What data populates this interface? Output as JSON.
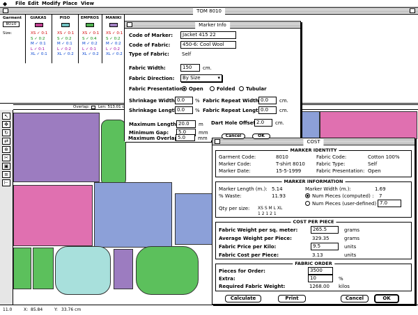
{
  "menubar": {
    "items": [
      "File",
      "Edit",
      "Modify",
      "Place",
      "View"
    ]
  },
  "main_window": {
    "title": "TOM 8010"
  },
  "top_panel": {
    "garment_label": "Garment",
    "garment_value": "8010",
    "size_label": "Size:",
    "columns": [
      {
        "name": "GIAKAS",
        "color": "#c04090",
        "sizes": [
          "XS ✓ 0:1",
          "S ✓ 0:2",
          "M ✓ 0:1",
          "L ✓ 0:1",
          "XL ✓ 0:1"
        ]
      },
      {
        "name": "PISO",
        "color": "#70c0c0",
        "sizes": [
          "XS ✓ 0:1",
          "S ✓ 0:2",
          "M ✓ 0:1",
          "L ✓ 0:2",
          "XL ✓ 0:2"
        ]
      },
      {
        "name": "EMPROS",
        "color": "#50b050",
        "sizes": [
          "XS ✓ 0:1",
          "S ✓ 0:4",
          "M ✓ 0:2",
          "L ✓ 0:1",
          "XL ✓ 0:2"
        ]
      },
      {
        "name": "MANIKI",
        "color": "#a080c0",
        "sizes": [
          "XS ✓ 0:1",
          "S ✓ 0:2",
          "M ✓ 0:2",
          "L ✓ 0:2",
          "XL ✓ 0:2"
        ]
      }
    ]
  },
  "ruler": {
    "overlap_label": "Overlap:",
    "len_label": "Len: 513.01 cm"
  },
  "status": {
    "zoom": "11.0",
    "x_label": "X:",
    "x_value": "85.84",
    "y_label": "Y:",
    "y_value": "33.76 cm"
  },
  "marker_info": {
    "title": "Marker Info",
    "code_of_marker_label": "Code of Marker:",
    "code_of_marker": "Jacket 415 22",
    "code_of_fabric_label": "Code of Fabric:",
    "code_of_fabric": "450-6: Cool Wool",
    "type_of_fabric_label": "Type of Fabric:",
    "type_of_fabric": "Self",
    "fabric_width_label": "Fabric Width:",
    "fabric_width": "150",
    "fabric_width_unit": "cm.",
    "fabric_direction_label": "Fabric Direction:",
    "fabric_direction": "By Size",
    "fabric_presentation_label": "Fabric Presentation:",
    "presentation_options": [
      "Open",
      "Folded",
      "Tubular"
    ],
    "presentation_selected": "Open",
    "shrinkage_width_label": "Shrinkage Width:",
    "shrinkage_width": "0.0",
    "shrinkage_length_label": "Shrinkage Length:",
    "shrinkage_length": "0.0",
    "pct": "%",
    "repeat_width_label": "Fabric Repeat Width:",
    "repeat_width": "0.0",
    "repeat_length_label": "Fabric Repeat Length:",
    "repeat_length": "0.0",
    "max_length_label": "Maximum Length:",
    "max_length": "20.0",
    "max_length_unit": "m",
    "min_gap_label": "Minimum Gap:",
    "min_gap": "5.0",
    "min_gap_unit": "mm",
    "max_overlap_label": "Maximum Overlap:",
    "max_overlap": "5.0",
    "max_overlap_unit": "mm",
    "dart_hole_label": "Dart Hole Offset:",
    "dart_hole": "2.0",
    "cm": "cm.",
    "cancel": "Cancel",
    "ok": "OK"
  },
  "cost": {
    "title": "COST",
    "marker_identity": {
      "title": "MARKER IDENTITY",
      "garment_code_label": "Garment Code:",
      "garment_code": "8010",
      "marker_code_label": "Marker Code:",
      "marker_code": "T-shirt 8010",
      "marker_date_label": "Marker Date:",
      "marker_date": "15-5-1999",
      "fabric_code_label": "Fabric Code:",
      "fabric_code": "Cotton 100%",
      "fabric_type_label": "Fabric Type:",
      "fabric_type": "Self",
      "fabric_presentation_label": "Fabric Presentation:",
      "fabric_presentation": "Open"
    },
    "marker_information": {
      "title": "MARKER INFORMATION",
      "length_label": "Marker Length (m.):",
      "length": "5.14",
      "waste_label": "% Waste:",
      "waste": "11.93",
      "width_label": "Marker Width (m.):",
      "width": "1.69",
      "num_computed_label": "Num Pieces (computed) :",
      "num_computed": "7",
      "num_user_label": "Num Pieces (user-defined) :",
      "num_user": "7.0",
      "qty_label": "Qty per size:",
      "qty_sizes": "XS S M L XL",
      "qty_values": "1  2  1  2  1"
    },
    "cost_per_piece": {
      "title": "COST PER PIECE",
      "weight_label": "Fabric Weight per sq. meter:",
      "weight": "265.5",
      "weight_unit": "grams",
      "avg_label": "Average Weight per Piece:",
      "avg": "329.35",
      "avg_unit": "grams",
      "price_label": "Fabric Price per Kilo:",
      "price": "9.5",
      "price_unit": "units",
      "fcost_label": "Fabric Cost per Piece:",
      "fcost": "3.13",
      "fcost_unit": "units"
    },
    "fabric_order": {
      "title": "FABRIC ORDER",
      "pieces_label": "Pieces for Order:",
      "pieces": "3500",
      "extra_label": "Extra:",
      "extra": "10",
      "extra_unit": "%",
      "required_label": "Required Fabric Weight:",
      "required": "1268.00",
      "required_unit": "kilos"
    },
    "buttons": {
      "calculate": "Calculate",
      "print": "Print",
      "cancel": "Cancel",
      "ok": "OK"
    }
  }
}
